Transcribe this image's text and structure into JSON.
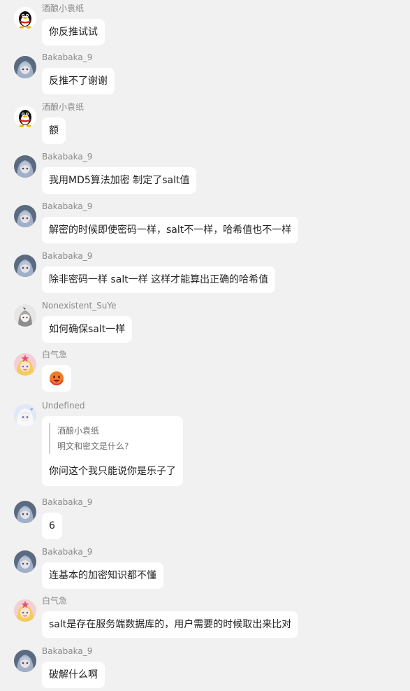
{
  "messages": [
    {
      "sender": "酒酿小袁纸",
      "avatar": "qq-penguin-icon",
      "text": "你反推试试"
    },
    {
      "sender": "Bakabaka_9",
      "avatar": "anime-girl-avatar",
      "text": "反推不了谢谢"
    },
    {
      "sender": "酒酿小袁纸",
      "avatar": "qq-penguin-icon",
      "text": "额"
    },
    {
      "sender": "Bakabaka_9",
      "avatar": "anime-girl-avatar",
      "text": "我用MD5算法加密 制定了salt值"
    },
    {
      "sender": "Bakabaka_9",
      "avatar": "anime-girl-avatar",
      "text": "解密的时候即使密码一样，salt不一样，哈希值也不一样"
    },
    {
      "sender": "Bakabaka_9",
      "avatar": "anime-girl-avatar",
      "text": "除非密码一样 salt一样 这样才能算出正确的哈希值"
    },
    {
      "sender": "Nonexistent_SuYe",
      "avatar": "grey-character-avatar",
      "text": "如何确保salt一样"
    },
    {
      "sender": "白气急",
      "avatar": "star-girl-avatar",
      "emoji": "hot-face-emoji"
    },
    {
      "sender": "Undefined",
      "avatar": "white-hair-girl-avatar",
      "quote": {
        "author": "酒酿小袁纸",
        "text": "明文和密文是什么?"
      },
      "text": "你问这个我只能说你是乐子了"
    },
    {
      "sender": "Bakabaka_9",
      "avatar": "anime-girl-avatar",
      "text": "6"
    },
    {
      "sender": "Bakabaka_9",
      "avatar": "anime-girl-avatar",
      "text": "连基本的加密知识都不懂"
    },
    {
      "sender": "白气急",
      "avatar": "star-girl-avatar",
      "text": "salt是存在服务端数据库的，用户需要的时候取出来比对"
    },
    {
      "sender": "Bakabaka_9",
      "avatar": "anime-girl-avatar",
      "text": "破解什么啊"
    }
  ]
}
